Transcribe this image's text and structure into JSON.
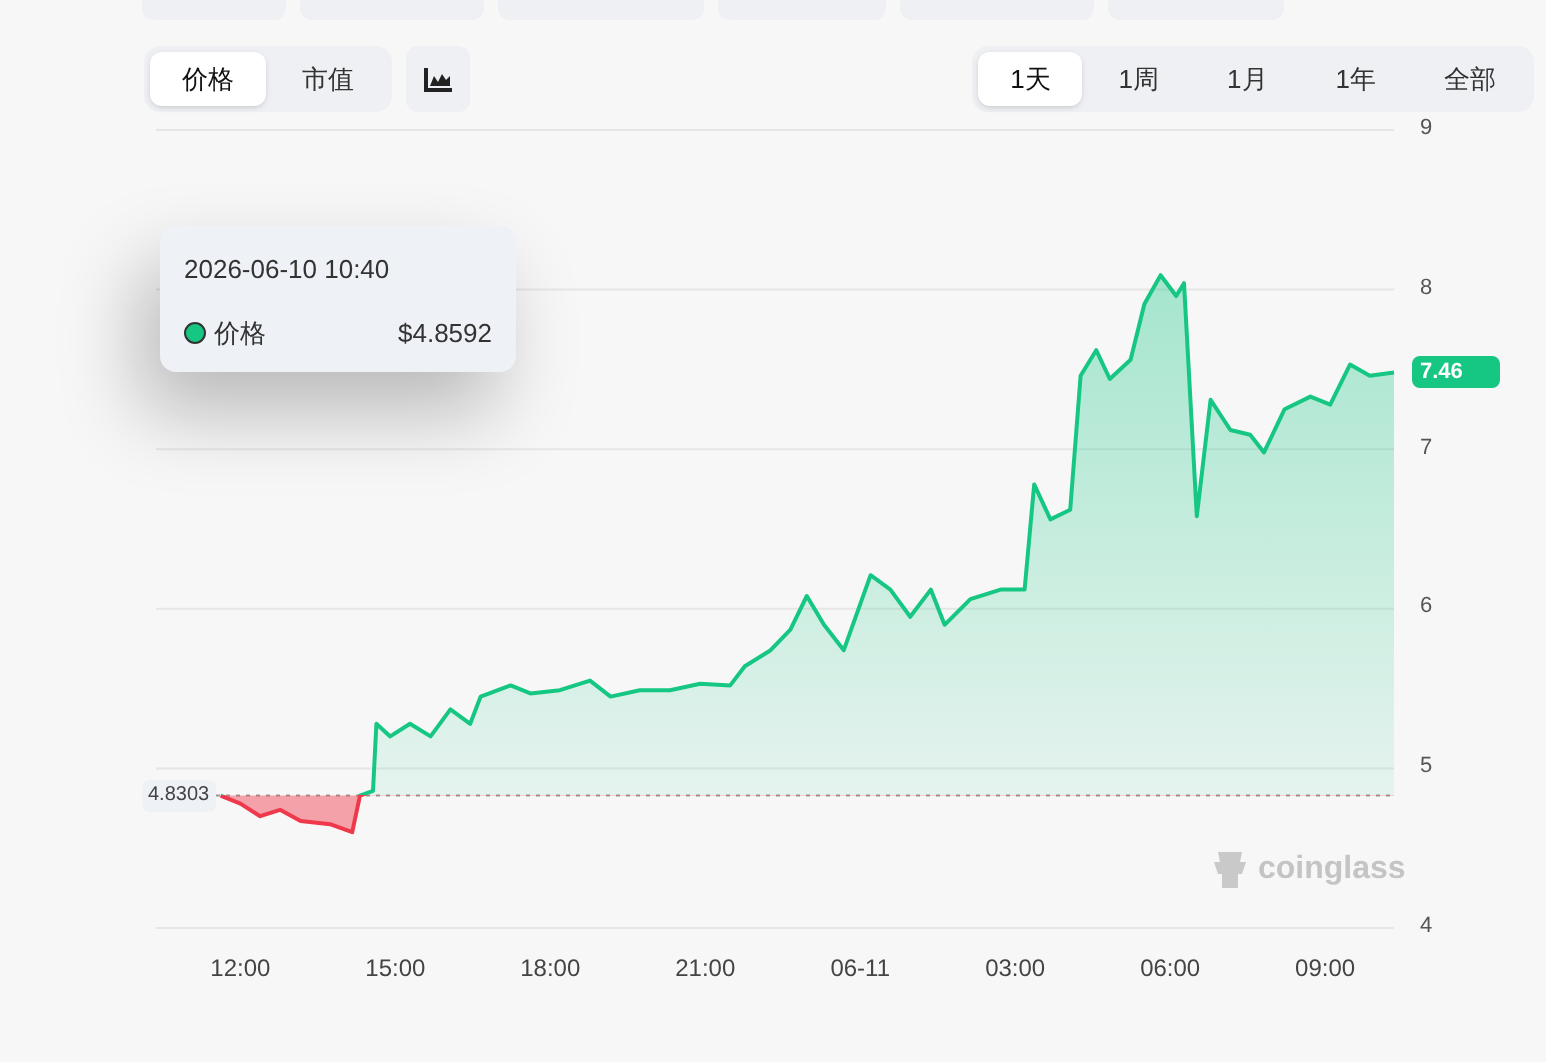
{
  "metric_tabs": [
    {
      "label": "价格",
      "selected": true
    },
    {
      "label": "市值",
      "selected": false
    }
  ],
  "range_tabs": [
    {
      "label": "1天",
      "selected": true
    },
    {
      "label": "1周",
      "selected": false
    },
    {
      "label": "1月",
      "selected": false
    },
    {
      "label": "1年",
      "selected": false
    },
    {
      "label": "全部",
      "selected": false
    }
  ],
  "chart": {
    "chart_data": {
      "type": "area",
      "grid": true,
      "x": [
        "2026-06-10T11:37",
        "2026-06-10T12:00",
        "2026-06-10T12:23",
        "2026-06-10T12:46",
        "2026-06-10T13:10",
        "2026-06-10T13:44",
        "2026-06-10T14:10",
        "2026-06-10T14:19",
        "2026-06-10T14:34",
        "2026-06-10T14:38",
        "2026-06-10T14:54",
        "2026-06-10T15:17",
        "2026-06-10T15:41",
        "2026-06-10T16:04",
        "2026-06-10T16:27",
        "2026-06-10T16:39",
        "2026-06-10T17:14",
        "2026-06-10T17:37",
        "2026-06-10T18:11",
        "2026-06-10T18:46",
        "2026-06-10T19:10",
        "2026-06-10T19:44",
        "2026-06-10T20:19",
        "2026-06-10T20:54",
        "2026-06-10T21:29",
        "2026-06-10T21:46",
        "2026-06-10T22:16",
        "2026-06-10T22:39",
        "2026-06-10T22:58",
        "2026-06-10T23:18",
        "2026-06-10T23:41",
        "2026-06-11T00:12",
        "2026-06-11T00:35",
        "2026-06-11T00:58",
        "2026-06-11T01:22",
        "2026-06-11T01:38",
        "2026-06-11T02:08",
        "2026-06-11T02:43",
        "2026-06-11T03:11",
        "2026-06-11T03:22",
        "2026-06-11T03:41",
        "2026-06-11T04:04",
        "2026-06-11T04:16",
        "2026-06-11T04:34",
        "2026-06-11T04:50",
        "2026-06-11T05:14",
        "2026-06-11T05:30",
        "2026-06-11T05:49",
        "2026-06-11T06:07",
        "2026-06-11T06:16",
        "2026-06-11T06:31",
        "2026-06-11T06:47",
        "2026-06-11T07:10",
        "2026-06-11T07:33",
        "2026-06-11T07:49",
        "2026-06-11T08:13",
        "2026-06-11T08:43",
        "2026-06-11T09:06",
        "2026-06-11T09:29",
        "2026-06-11T09:52",
        "2026-06-11T10:20"
      ],
      "series": [
        {
          "name": "价格",
          "color": "#16c784",
          "values": [
            4.83,
            4.78,
            4.7,
            4.74,
            4.67,
            4.65,
            4.6,
            4.83,
            4.86,
            5.28,
            5.2,
            5.28,
            5.2,
            5.37,
            5.28,
            5.45,
            5.52,
            5.47,
            5.49,
            5.55,
            5.45,
            5.49,
            5.49,
            5.53,
            5.52,
            5.64,
            5.74,
            5.87,
            6.08,
            5.9,
            5.74,
            6.21,
            6.12,
            5.95,
            6.12,
            5.9,
            6.06,
            6.12,
            6.12,
            6.78,
            6.56,
            6.62,
            7.46,
            7.62,
            7.44,
            7.56,
            7.91,
            8.09,
            7.96,
            8.04,
            6.58,
            7.31,
            7.12,
            7.09,
            6.98,
            7.25,
            7.33,
            7.28,
            7.53,
            7.46,
            7.48
          ]
        }
      ],
      "xlim": [
        "2026-06-10T10:22",
        "2026-06-11T10:20"
      ],
      "ylim": [
        4,
        9
      ],
      "yticks": [
        4,
        5,
        6,
        7,
        8,
        9
      ],
      "xticks": [
        {
          "value": "2026-06-10T12:00",
          "label": "12:00"
        },
        {
          "value": "2026-06-10T15:00",
          "label": "15:00"
        },
        {
          "value": "2026-06-10T18:00",
          "label": "18:00"
        },
        {
          "value": "2026-06-10T21:00",
          "label": "21:00"
        },
        {
          "value": "2026-06-11T00:00",
          "label": "06-11"
        },
        {
          "value": "2026-06-11T03:00",
          "label": "03:00"
        },
        {
          "value": "2026-06-11T06:00",
          "label": "06:00"
        },
        {
          "value": "2026-06-11T09:00",
          "label": "09:00"
        }
      ],
      "ref_lines": [
        {
          "axis": "y",
          "value": 4.8303,
          "label": "4.8303"
        }
      ]
    },
    "last_price_label": "7.46",
    "watermark": "coinglass"
  },
  "tooltip": {
    "time": "2026-06-10 10:40",
    "value": "$4.8592"
  }
}
